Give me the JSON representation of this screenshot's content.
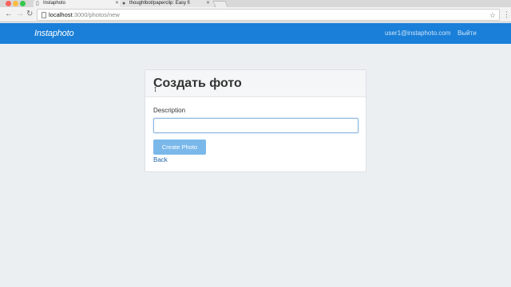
{
  "browser": {
    "tabs": [
      {
        "title": "Instaphoto",
        "icon": "page-icon"
      },
      {
        "title": "thoughtbot/paperclip: Easy fi",
        "icon": "github-icon"
      }
    ],
    "address": {
      "host": "localhost",
      "path": ":3000/photos/new"
    }
  },
  "navbar": {
    "brand": "Instaphoto",
    "user_email": "user1@instaphoto.com",
    "logout_label": "Выйти",
    "background": "#1a7fd8"
  },
  "form": {
    "title": "Создать фото",
    "description_label": "Description",
    "description_value": "",
    "submit_label": "Create Photo",
    "back_label": "Back",
    "submit_color": "#7ab8ea"
  }
}
